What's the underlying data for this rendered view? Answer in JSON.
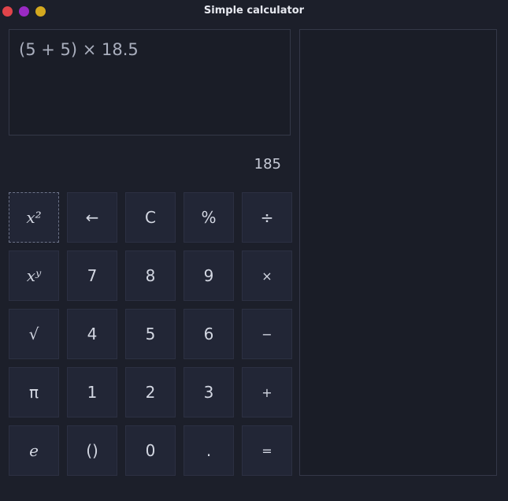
{
  "window": {
    "title": "Simple calculator",
    "controls": [
      "close",
      "minimize",
      "maximize"
    ]
  },
  "display": {
    "expression": "(5 + 5) × 18.5",
    "result": "185"
  },
  "keys": [
    [
      "x²",
      "←",
      "C",
      "%",
      "÷"
    ],
    [
      "xʸ",
      "7",
      "8",
      "9",
      "×"
    ],
    [
      "√",
      "4",
      "5",
      "6",
      "−"
    ],
    [
      "π",
      "1",
      "2",
      "3",
      "+"
    ],
    [
      "e",
      "()",
      "0",
      ".",
      "="
    ]
  ],
  "colors": {
    "background": "#1c1f2a",
    "key": "#222636",
    "close": "#e0444a",
    "minimize": "#9a2ac4",
    "maximize": "#d4a91f"
  }
}
